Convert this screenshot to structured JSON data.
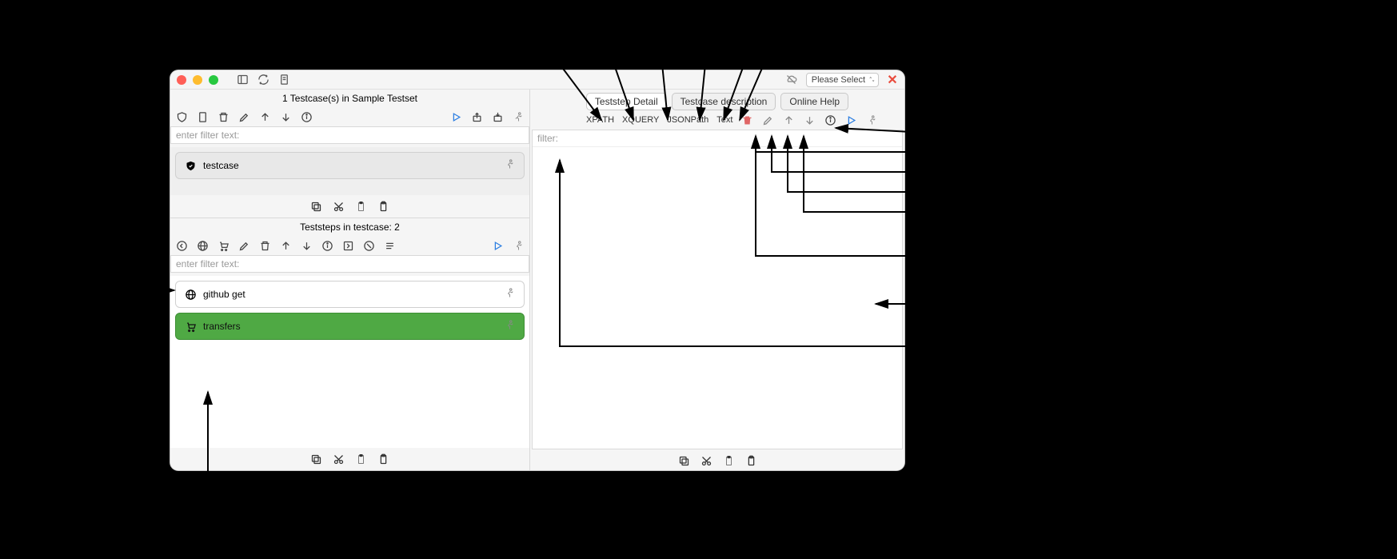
{
  "titlebar": {
    "select_placeholder": "Please Select"
  },
  "left": {
    "testcases_title": "1 Testcase(s) in Sample Testset",
    "testcase_filter_placeholder": "enter filter text:",
    "testcase_label": "testcase",
    "teststeps_title": "Teststeps in testcase: 2",
    "teststep_filter_placeholder": "enter filter text:",
    "teststeps": [
      {
        "label": "github get"
      },
      {
        "label": "transfers"
      }
    ]
  },
  "right": {
    "tabs": {
      "detail": "Teststep Detail",
      "description": "Testcase description",
      "help": "Online Help"
    },
    "typebar": {
      "xpath": "XPATH",
      "xquery": "XQUERY",
      "jsonpath": "JSONPath",
      "text": "Text"
    },
    "filter_placeholder": "filter:"
  }
}
